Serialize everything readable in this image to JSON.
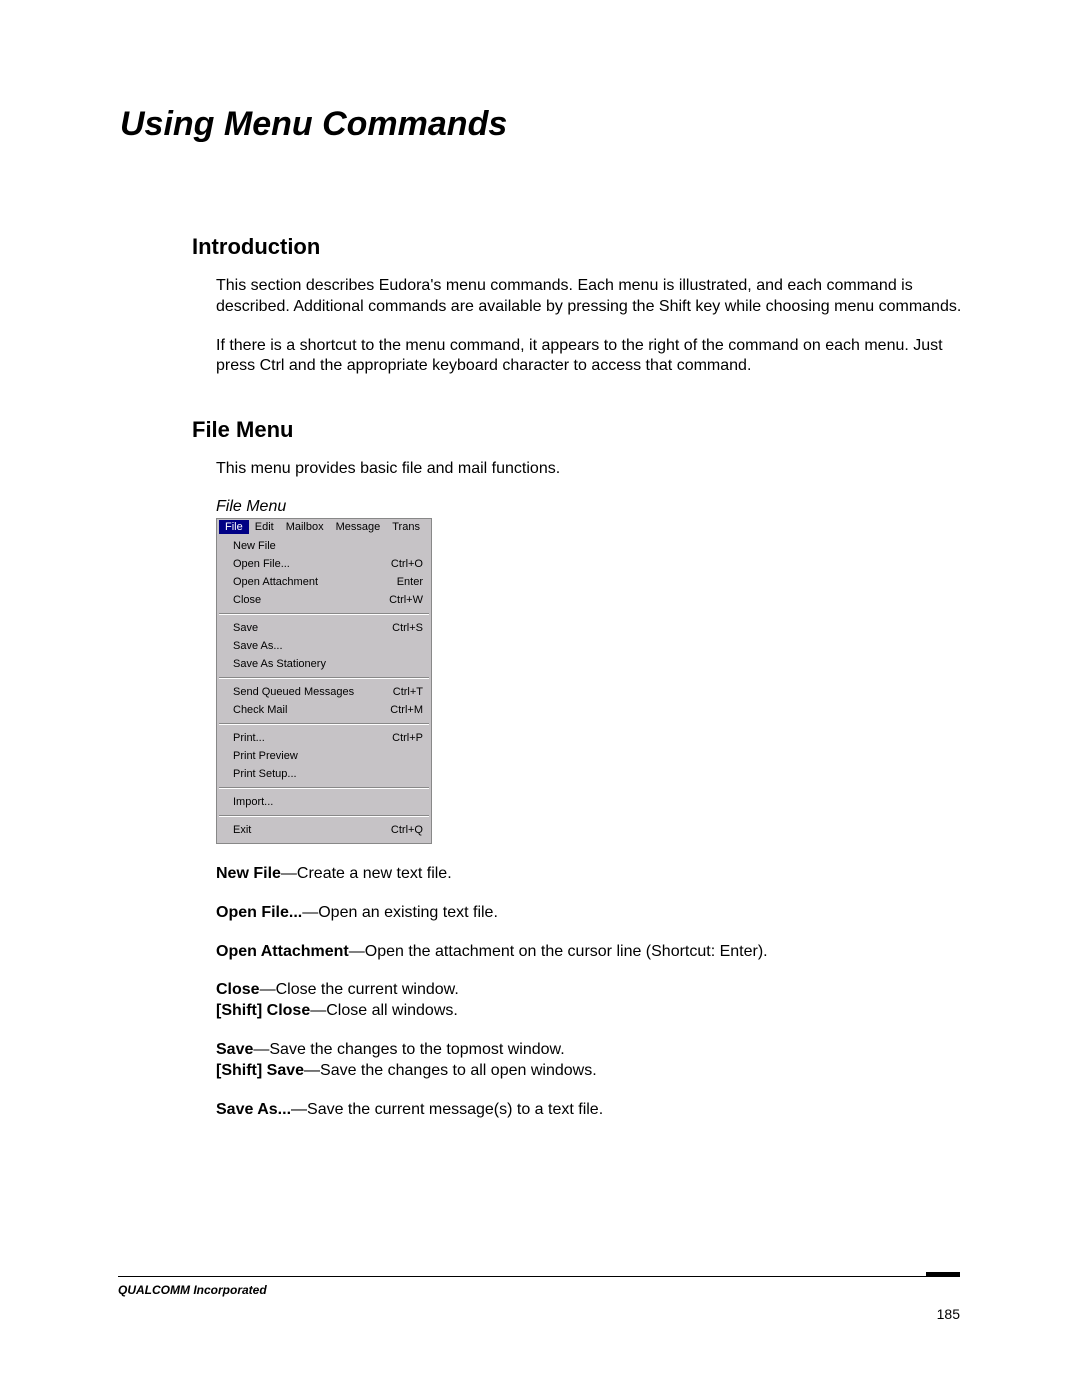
{
  "chapter_title": "Using Menu Commands",
  "intro": {
    "heading": "Introduction",
    "p1": "This section describes Eudora's menu commands. Each menu is illustrated, and each command is described. Additional commands are available by pressing the Shift key while choosing menu commands.",
    "p2": "If there is a shortcut to the menu command, it appears to the right of the command on each menu. Just press Ctrl and the appropriate keyboard character to access that command."
  },
  "filemenu": {
    "heading": "File Menu",
    "intro": "This menu provides basic file and mail functions.",
    "caption": "File Menu",
    "menubar": [
      "File",
      "Edit",
      "Mailbox",
      "Message",
      "Trans"
    ],
    "groups": [
      [
        {
          "label": "New File",
          "shortcut": ""
        },
        {
          "label": "Open File...",
          "shortcut": "Ctrl+O"
        },
        {
          "label": "Open Attachment",
          "shortcut": "Enter"
        },
        {
          "label": "Close",
          "shortcut": "Ctrl+W"
        }
      ],
      [
        {
          "label": "Save",
          "shortcut": "Ctrl+S"
        },
        {
          "label": "Save As...",
          "shortcut": ""
        },
        {
          "label": "Save As Stationery",
          "shortcut": ""
        }
      ],
      [
        {
          "label": "Send Queued Messages",
          "shortcut": "Ctrl+T"
        },
        {
          "label": "Check Mail",
          "shortcut": "Ctrl+M"
        }
      ],
      [
        {
          "label": "Print...",
          "shortcut": "Ctrl+P"
        },
        {
          "label": "Print Preview",
          "shortcut": ""
        },
        {
          "label": "Print Setup...",
          "shortcut": ""
        }
      ],
      [
        {
          "label": "Import...",
          "shortcut": ""
        }
      ],
      [
        {
          "label": "Exit",
          "shortcut": "Ctrl+Q"
        }
      ]
    ]
  },
  "defs": {
    "new_file_name": "New File",
    "new_file_desc": "—Create a new text file.",
    "open_file_name": "Open File...",
    "open_file_desc": "—Open an existing text file.",
    "open_att_name": "Open Attachment",
    "open_att_desc": "—Open the attachment on the cursor line (Shortcut: Enter).",
    "close_name": "Close",
    "close_desc": "—Close the current window.",
    "shift_close_name": "[Shift] Close",
    "shift_close_desc": "—Close all windows.",
    "save_name": "Save",
    "save_desc": "—Save the changes to the topmost window.",
    "shift_save_name": "[Shift] Save",
    "shift_save_desc": "—Save the changes to all open windows.",
    "save_as_name": "Save As...",
    "save_as_desc": "—Save the current message(s) to a text file."
  },
  "footer": {
    "company": "QUALCOMM Incorporated",
    "page": "185"
  }
}
